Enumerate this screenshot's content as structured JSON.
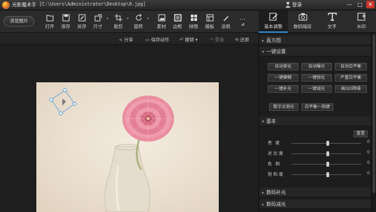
{
  "window": {
    "app_title": "光影魔术手",
    "file_path": "[C:\\Users\\Administrator\\Desktop\\0.jpg]",
    "login_label": "登录",
    "minimize_label": "—",
    "maximize_label": "□",
    "close_label": "✕"
  },
  "toolbar": {
    "browse_label": "浏览图片",
    "tools": [
      {
        "label": "打开",
        "icon": "open-icon"
      },
      {
        "label": "保存",
        "icon": "save-icon"
      },
      {
        "label": "另存",
        "icon": "save-as-icon"
      },
      {
        "label": "尺寸",
        "icon": "resize-icon"
      },
      {
        "label": "裁剪",
        "icon": "crop-icon"
      },
      {
        "label": "旋转",
        "icon": "rotate-icon"
      },
      {
        "label": "素材",
        "icon": "material-icon"
      },
      {
        "label": "边框",
        "icon": "border-icon"
      },
      {
        "label": "拼图",
        "icon": "collage-icon"
      },
      {
        "label": "模板",
        "icon": "template-icon"
      },
      {
        "label": "涂鸦",
        "icon": "doodle-icon"
      },
      {
        "label": "...",
        "icon": "more-icon"
      }
    ],
    "right_tabs": [
      {
        "label": "基本调整",
        "icon": "basic-adjust-icon"
      },
      {
        "label": "数码暗房",
        "icon": "darkroom-icon"
      },
      {
        "label": "文字",
        "icon": "text-icon"
      },
      {
        "label": "水印",
        "icon": "watermark-icon"
      }
    ]
  },
  "subbar": {
    "share": "分享",
    "save_action": "保存动作",
    "undo": "撤销",
    "redo": "重做",
    "restore": "还原"
  },
  "panel": {
    "histogram": "直方图",
    "one_click": "一键设置",
    "one_click_buttons": [
      "自动美化",
      "自动曝光",
      "自动白平衡",
      "一键模糊",
      "一键锐化",
      "严重白平衡",
      "一键补光",
      "一键减光",
      "高ISO降噪"
    ],
    "digital_flash": "数字点测光",
    "white_balance": "白平衡一指键",
    "basic": "基本",
    "reset": "重置",
    "sliders": [
      {
        "label": "亮度",
        "value": "0"
      },
      {
        "label": "对比度",
        "value": "0"
      },
      {
        "label": "色相",
        "value": "0"
      },
      {
        "label": "饱和度",
        "value": "0"
      }
    ],
    "digital_fill": "数码补光",
    "digital_reduce": "数码减光"
  },
  "colors": {
    "accent": "#2f8ad8",
    "background": "#1b1b1b"
  }
}
